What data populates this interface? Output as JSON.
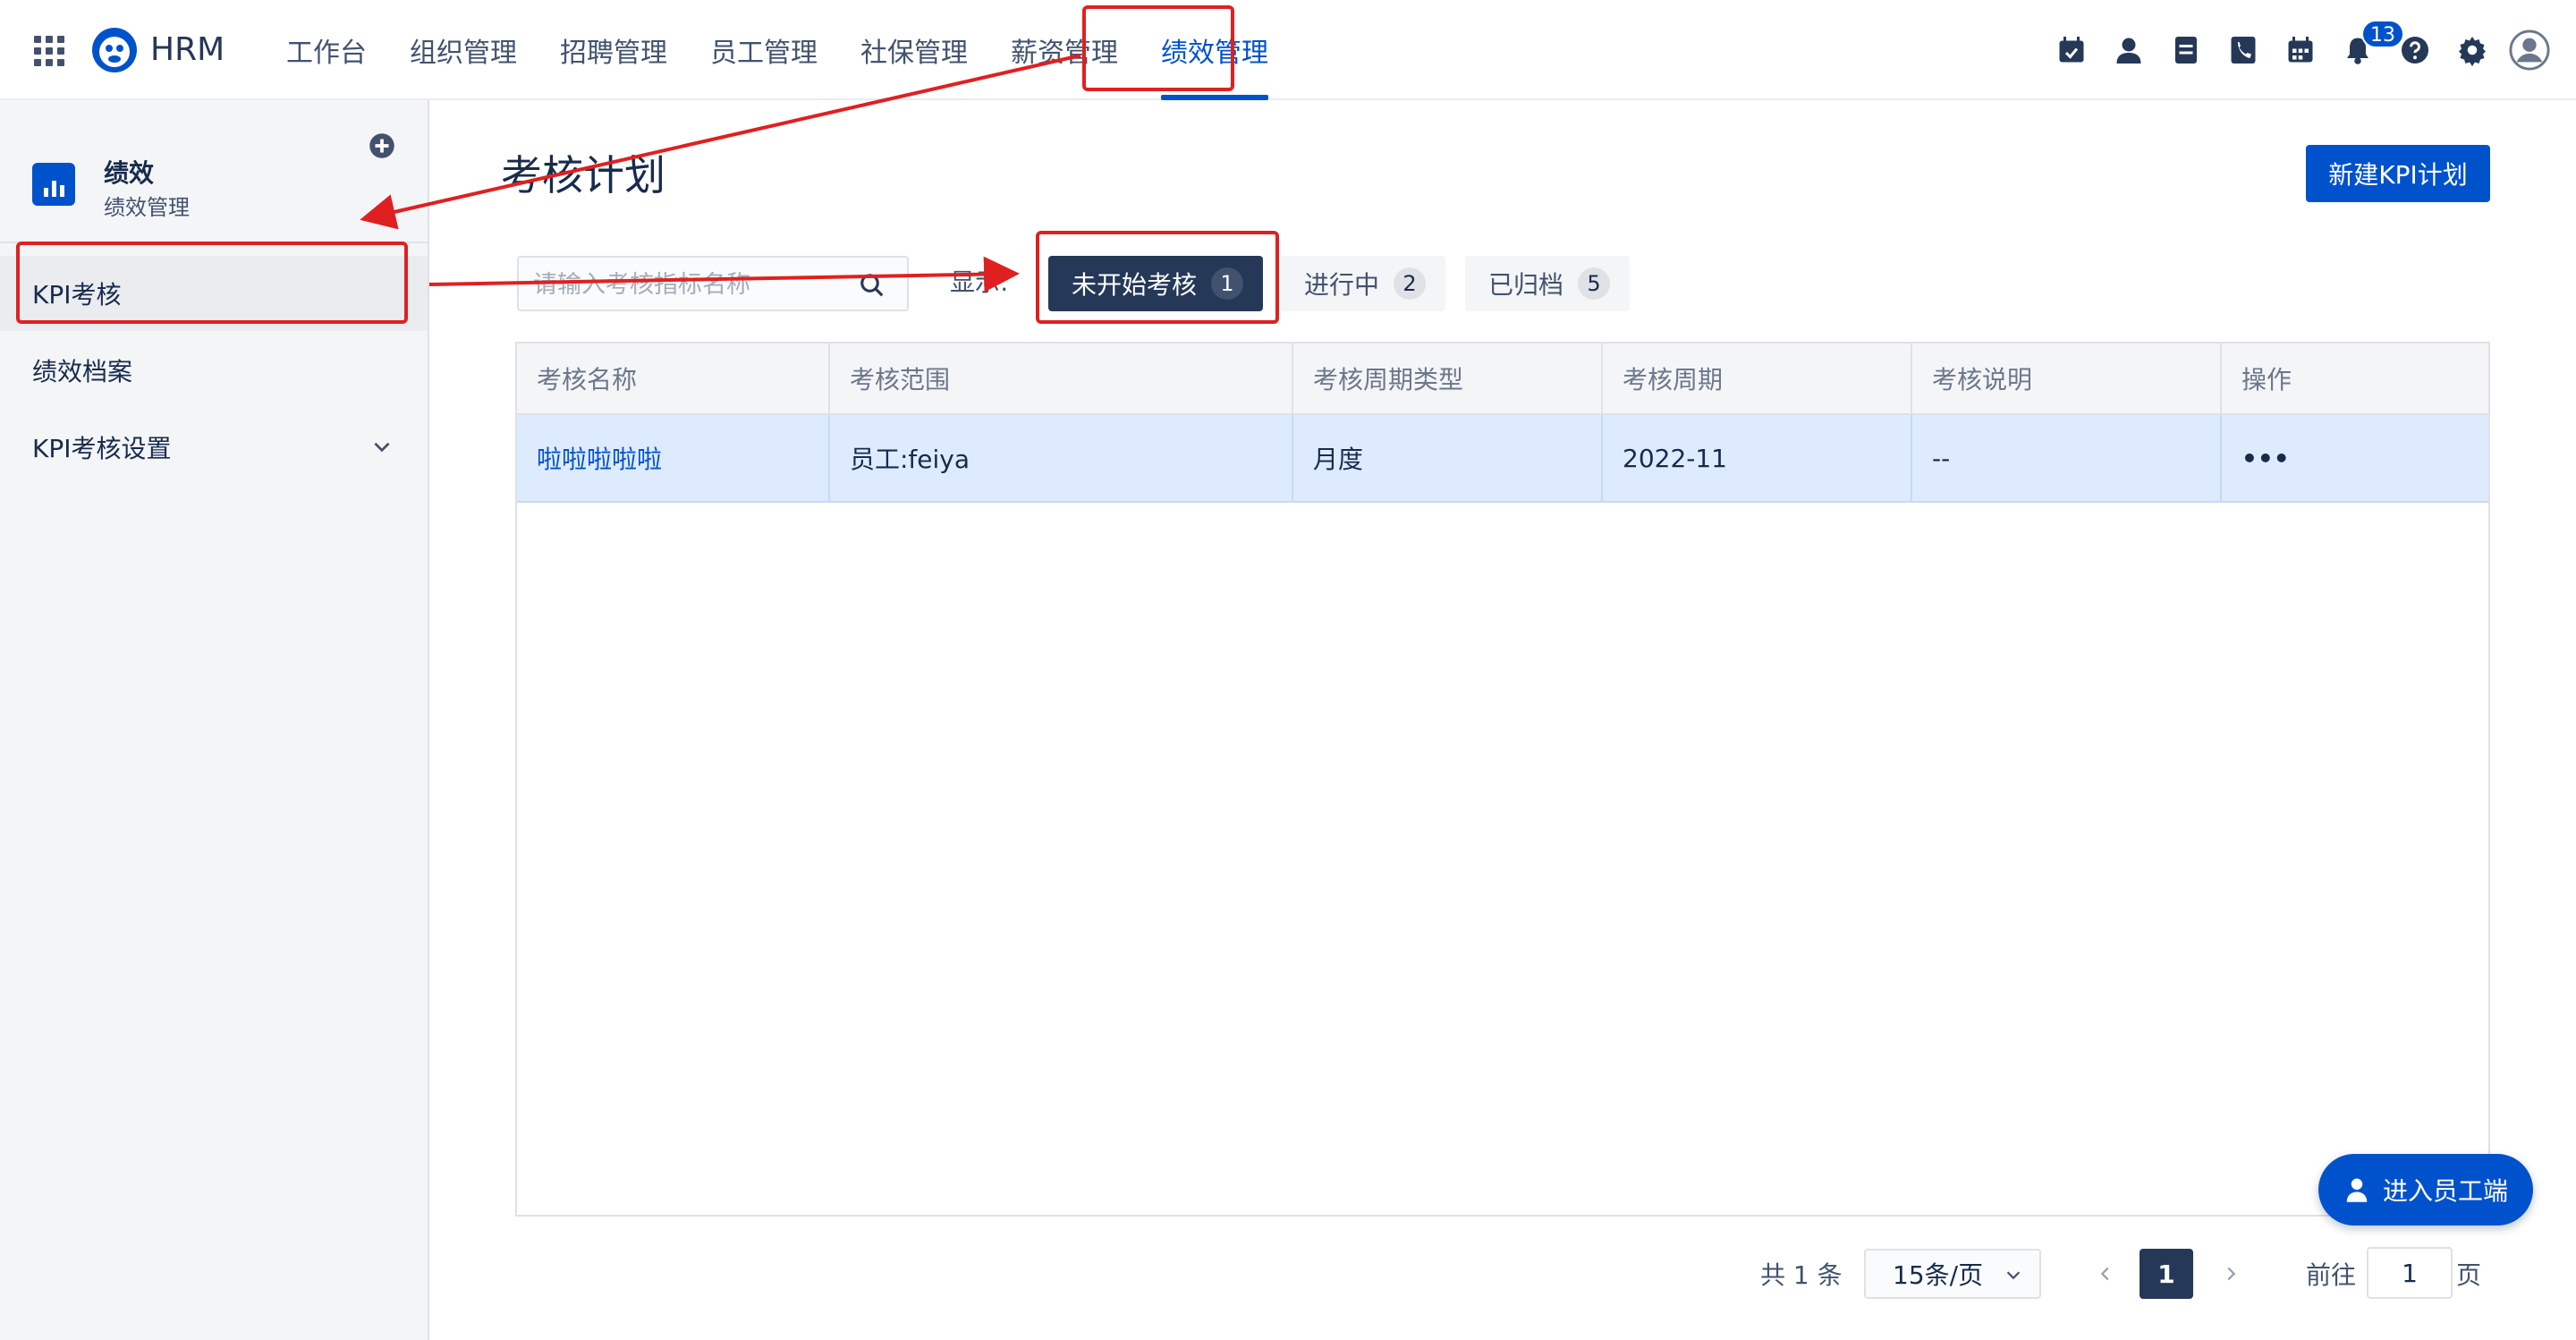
{
  "app": {
    "name": "HRM"
  },
  "nav": {
    "items": [
      {
        "label": "工作台"
      },
      {
        "label": "组织管理"
      },
      {
        "label": "招聘管理"
      },
      {
        "label": "员工管理"
      },
      {
        "label": "社保管理"
      },
      {
        "label": "薪资管理"
      },
      {
        "label": "绩效管理",
        "active": true
      }
    ]
  },
  "toolbar": {
    "icons": [
      "calendar-check-icon",
      "person-icon",
      "document-icon",
      "phone-icon",
      "calendar-icon",
      "bell-icon",
      "help-icon",
      "gear-icon",
      "avatar-icon"
    ],
    "notification_count": "13"
  },
  "sidebar": {
    "title": "绩效",
    "subtitle": "绩效管理",
    "items": [
      {
        "label": "KPI考核",
        "active": true
      },
      {
        "label": "绩效档案"
      },
      {
        "label": "KPI考核设置",
        "expandable": true
      }
    ]
  },
  "main": {
    "title": "考核计划",
    "new_button": "新建KPI计划",
    "search": {
      "placeholder": "请输入考核指标名称",
      "value": ""
    },
    "filter_label": "显示:",
    "filters": [
      {
        "label": "未开始考核",
        "count": "1",
        "active": true
      },
      {
        "label": "进行中",
        "count": "2"
      },
      {
        "label": "已归档",
        "count": "5"
      }
    ],
    "table": {
      "columns": [
        "考核名称",
        "考核范围",
        "考核周期类型",
        "考核周期",
        "考核说明",
        "操作"
      ],
      "rows": [
        {
          "name": "啦啦啦啦啦",
          "scope": "员工:feiya",
          "cycle_type": "月度",
          "cycle": "2022-11",
          "note": "--",
          "action": "•••"
        }
      ]
    },
    "pagination": {
      "total": "共 1 条",
      "page_size": "15条/页",
      "current": "1",
      "goto_label": "前往",
      "goto_value": "1",
      "page_suffix": "页"
    },
    "staff_button": "进入员工端"
  },
  "colors": {
    "primary": "#0052cc",
    "dark": "#253858",
    "annotation": "#e02020",
    "selected_row": "#deebff"
  }
}
